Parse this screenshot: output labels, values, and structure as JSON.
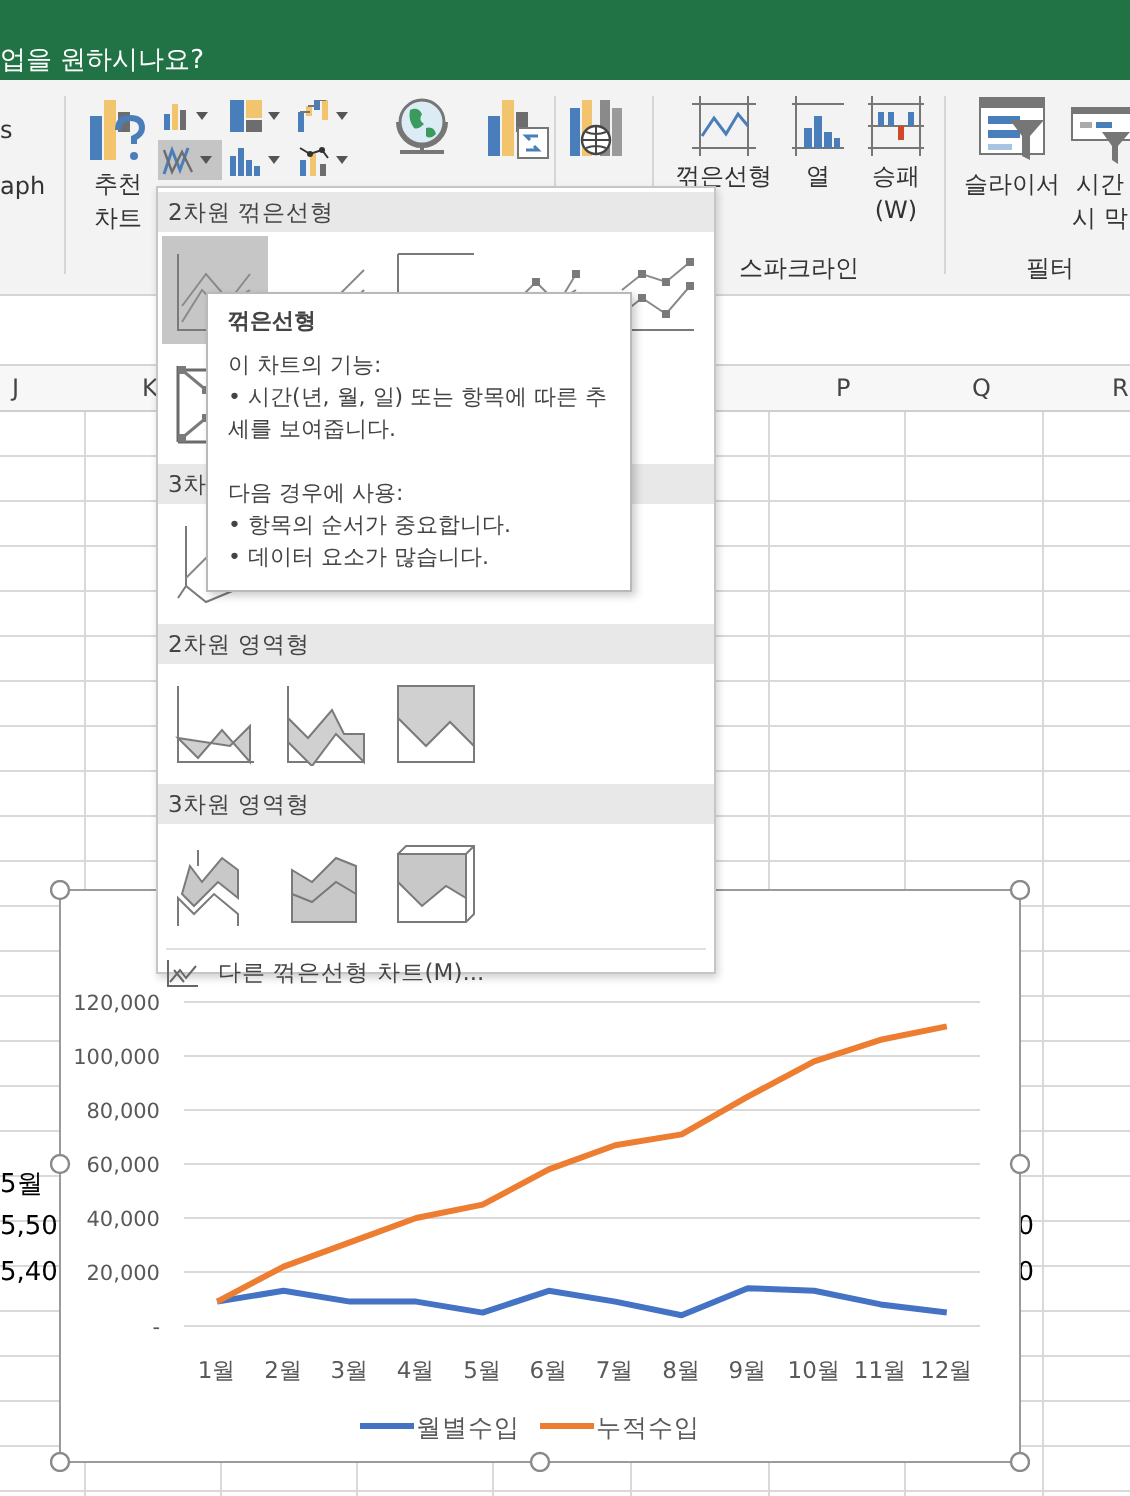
{
  "title_bar": {
    "tell_me": "업을 원하시나요?"
  },
  "ribbon": {
    "cut_labels": [
      "s",
      "aph"
    ],
    "groups": [
      {
        "buttons": [
          {
            "kind": "recommended",
            "label": "추천\n차트"
          },
          {
            "kind": "gallery",
            "items": [
              {
                "kind": "column",
                "selected": false
              },
              {
                "kind": "hierarchy",
                "selected": false
              },
              {
                "kind": "waterfall",
                "selected": false
              },
              {
                "kind": "line",
                "selected": true
              },
              {
                "kind": "histogram",
                "selected": false
              },
              {
                "kind": "scatter",
                "selected": false
              }
            ]
          },
          {
            "kind": "map"
          },
          {
            "kind": "pivot"
          }
        ]
      },
      {
        "buttons": [
          {
            "kind": "map3d"
          }
        ]
      },
      {
        "label": "스파크라인",
        "buttons": [
          {
            "kind": "spark-line",
            "label": "꺾은선형"
          },
          {
            "kind": "spark-column",
            "label": "열"
          },
          {
            "kind": "spark-winloss",
            "label": "승패\n(W)"
          }
        ]
      },
      {
        "label": "필터",
        "buttons": [
          {
            "kind": "slicer",
            "label": "슬라이서"
          },
          {
            "kind": "timeline",
            "label": "시간\n시 막"
          }
        ]
      }
    ]
  },
  "sheet": {
    "columns": [
      "J",
      "K",
      "P",
      "Q",
      "R"
    ],
    "left_cells": [
      "5월",
      "5,50",
      "5,40"
    ],
    "right_cells": [
      "0",
      "0"
    ]
  },
  "line_menu": {
    "sections": [
      {
        "title": "2차원 꺾은선형",
        "items": [
          {
            "kind": "line",
            "selected": true
          },
          {
            "kind": "stacked-line",
            "selected": false
          },
          {
            "kind": "percent-line",
            "selected": false
          },
          {
            "kind": "line-markers",
            "selected": false
          },
          {
            "kind": "stacked-line-markers",
            "selected": false
          },
          {
            "kind": "percent-line-markers",
            "selected": false
          }
        ]
      },
      {
        "title": "3차",
        "items": [
          {
            "kind": "line-3d",
            "selected": false
          }
        ]
      },
      {
        "title": "2차원 영역형",
        "items": [
          {
            "kind": "area",
            "selected": false
          },
          {
            "kind": "stacked-area",
            "selected": false
          },
          {
            "kind": "percent-area",
            "selected": false
          }
        ]
      },
      {
        "title": "3차원 영역형",
        "items": [
          {
            "kind": "area-3d",
            "selected": false
          },
          {
            "kind": "stacked-area-3d",
            "selected": false
          },
          {
            "kind": "percent-area-3d",
            "selected": false
          }
        ]
      }
    ],
    "footer": "다른 꺾은선형 차트(M)..."
  },
  "tooltip": {
    "title": "꺾은선형",
    "paragraphs": [
      {
        "heading": "이 차트의 기능:",
        "bullets": [
          "• 시간(년, 월, 일) 또는 항목에 따른 추세를 보여줍니다."
        ]
      },
      {
        "heading": "다음 경우에 사용:",
        "bullets": [
          "• 항목의 순서가 중요합니다.",
          "• 데이터 요소가 많습니다."
        ]
      }
    ]
  },
  "chart": {
    "chart_data": {
      "type": "line",
      "categories": [
        "1월",
        "2월",
        "3월",
        "4월",
        "5월",
        "6월",
        "7월",
        "8월",
        "9월",
        "10월",
        "11월",
        "12월"
      ],
      "series": [
        {
          "name": "월별수입",
          "color": "#4472c4",
          "values": [
            9000,
            13000,
            9000,
            9000,
            5000,
            13000,
            9000,
            4000,
            14000,
            13000,
            8000,
            5000
          ]
        },
        {
          "name": "누적수입",
          "color": "#ed7d31",
          "values": [
            9000,
            22000,
            31000,
            40000,
            45000,
            58000,
            67000,
            71000,
            85000,
            98000,
            106000,
            111000
          ]
        }
      ],
      "ylim": [
        0,
        120000
      ],
      "yticks": [
        {
          "value": 0,
          "label": "-"
        },
        {
          "value": 20000,
          "label": "20,000"
        },
        {
          "value": 40000,
          "label": "40,000"
        },
        {
          "value": 60000,
          "label": "60,000"
        },
        {
          "value": 80000,
          "label": "80,000"
        },
        {
          "value": 100000,
          "label": "100,000"
        },
        {
          "value": 120000,
          "label": "120,000"
        }
      ],
      "grid": true,
      "legend": true
    }
  }
}
